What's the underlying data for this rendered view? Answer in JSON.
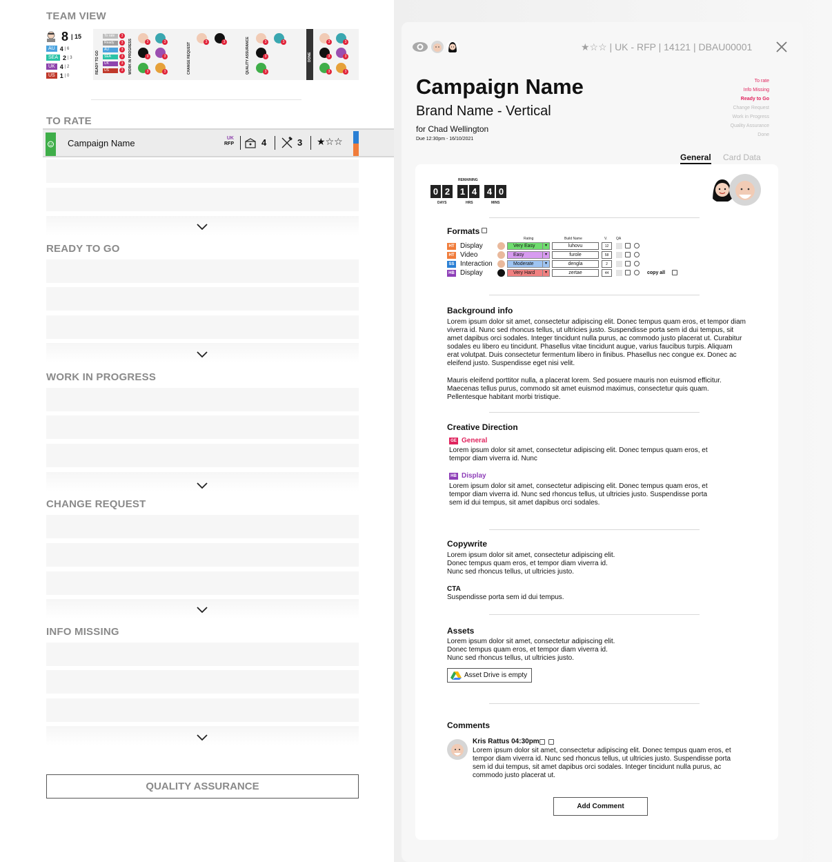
{
  "team_view": {
    "title": "TEAM VIEW",
    "total": "8",
    "total_of": "| 15",
    "regions": [
      {
        "code": "AU",
        "count": "4",
        "of": "| 6",
        "color": "#4aa3df"
      },
      {
        "code": "SEA",
        "count": "2",
        "of": "| 3",
        "color": "#2bc3a7"
      },
      {
        "code": "UK",
        "count": "4",
        "of": "| 2",
        "color": "#8e44ad"
      },
      {
        "code": "US",
        "count": "1",
        "of": "| 0",
        "color": "#c0392b"
      }
    ],
    "columns": [
      "READY TO GO",
      "WORK IN PROGRESS",
      "CHANGE REQUEST",
      "QUALITY ASSURANCE",
      "DONE"
    ],
    "mini_tags": [
      {
        "label": "To rate",
        "color": "#bdbdbd"
      },
      {
        "label": "Ready",
        "color": "#9e9e9e"
      },
      {
        "label": "AU",
        "color": "#4aa3df"
      },
      {
        "label": "SEA",
        "color": "#2bc3a7"
      },
      {
        "label": "UK",
        "color": "#8e44ad"
      },
      {
        "label": "US",
        "color": "#c0392b"
      }
    ],
    "badge": "3"
  },
  "sections": {
    "to_rate": "TO RATE",
    "ready_to_go": "READY TO GO",
    "work_in_progress": "WORK IN PROGRESS",
    "change_request": "CHANGE REQUEST",
    "info_missing": "INFO MISSING",
    "quality_assurance": "QUALITY ASSURANCE"
  },
  "active_card": {
    "name": "Campaign Name",
    "region_top": "UK",
    "region_bottom": "RFP",
    "formats_count": "4",
    "tools_count": "3",
    "stars": "★☆☆"
  },
  "detail": {
    "meta": "★☆☆ | UK - RFP | 14121 | DBAU00001",
    "title": "Campaign Name",
    "brand": "Brand Name - Vertical",
    "for": "for Chad Wellington",
    "due": "Due 12:30pm - 16/10/2021",
    "statuses": [
      "To rate",
      "Info Missing",
      "Ready to Go",
      "Change Request",
      "Work in Progress",
      "Quality Assurance",
      "Done"
    ],
    "tabs": {
      "general": "General",
      "card_data": "Card Data"
    },
    "timer": {
      "label": "REMAINING",
      "days": [
        "0",
        "2"
      ],
      "hrs": [
        "1",
        "4"
      ],
      "mins": [
        "4",
        "0"
      ],
      "days_label": "DAYS",
      "hrs_label": "HRS",
      "mins_label": "MINS"
    },
    "formats": {
      "heading": "Formats",
      "col_rating": "Rating",
      "col_build": "Build Name",
      "col_v": "V.",
      "col_qa": "QA",
      "copy_all": "copy all",
      "rows": [
        {
          "tag": "HT",
          "tag_color": "#f07c3a",
          "label": "Display",
          "rating": "Very Easy",
          "rating_color": "#6fdc6f",
          "build": "luhovu",
          "v": "12"
        },
        {
          "tag": "HT",
          "tag_color": "#f07c3a",
          "label": "Video",
          "rating": "Easy",
          "rating_color": "#d79bf0",
          "build": "furole",
          "v": "58"
        },
        {
          "tag": "SS",
          "tag_color": "#2a7fd4",
          "label": "Interaction",
          "rating": "Moderate",
          "rating_color": "#9ec4f2",
          "build": "dengla",
          "v": "2"
        },
        {
          "tag": "HB",
          "tag_color": "#8e3fb8",
          "label": "Display",
          "rating": "Very Hard",
          "rating_color": "#f08080",
          "build": "zertae",
          "v": "44"
        }
      ]
    },
    "background": {
      "heading": "Background info",
      "p1": "Lorem ipsum dolor sit amet, consectetur adipiscing elit. Donec tempus quam eros, et tempor diam viverra id. Nunc sed rhoncus tellus, ut ultricies justo. Suspendisse porta sem id dui tempus, sit amet dapibus orci sodales. Integer tincidunt nulla purus, ac commodo justo placerat ut. Curabitur sodales eu libero eu tincidunt. Phasellus vitae tincidunt augue, varius faucibus turpis. Aliquam erat volutpat. Duis consectetur fermentum libero in finibus. Phasellus nec congue ex. Donec ac eleifend justo. Suspendisse eget nisi velit.",
      "p2": "Mauris eleifend porttitor nulla, a placerat lorem. Sed posuere mauris non euismod efficitur. Maecenas tellus purus, commodo sit amet euismod maximus, consectetur quis quam. Pellentesque habitant morbi tristique."
    },
    "creative": {
      "heading": "Creative Direction",
      "general_tag": "GE",
      "general_label": "General",
      "general_text": "Lorem ipsum dolor sit amet, consectetur adipiscing elit. Donec tempus quam eros, et tempor diam viverra id. Nunc",
      "display_tag": "HB",
      "display_label": "Display",
      "display_text": "Lorem ipsum dolor sit amet, consectetur adipiscing elit. Donec tempus quam eros, et tempor diam viverra id. Nunc sed rhoncus tellus, ut ultricies justo. Suspendisse porta sem id dui tempus, sit amet dapibus orci sodales."
    },
    "copywrite": {
      "heading": "Copywrite",
      "text": "Lorem ipsum dolor sit amet, consectetur adipiscing elit. Donec tempus quam eros, et tempor diam viverra id. Nunc sed rhoncus tellus, ut ultricies justo.",
      "cta_label": "CTA",
      "cta_text": "Suspendisse porta sem id dui tempus."
    },
    "assets": {
      "heading": "Assets",
      "text": "Lorem ipsum dolor sit amet, consectetur adipiscing elit. Donec tempus quam eros, et tempor diam viverra id. Nunc sed rhoncus tellus, ut ultricies justo.",
      "drive_button": "Asset Drive is empty"
    },
    "comments": {
      "heading": "Comments",
      "author": "Kris Rattus 04:30pm",
      "text": "Lorem ipsum dolor sit amet, consectetur adipiscing elit. Donec tempus quam eros, et tempor diam viverra id. Nunc sed rhoncus tellus, ut ultricies justo. Suspendisse porta sem id dui tempus, sit amet dapibus orci sodales. Integer tincidunt nulla purus, ac commodo justo placerat ut.",
      "add_button": "Add Comment"
    }
  }
}
